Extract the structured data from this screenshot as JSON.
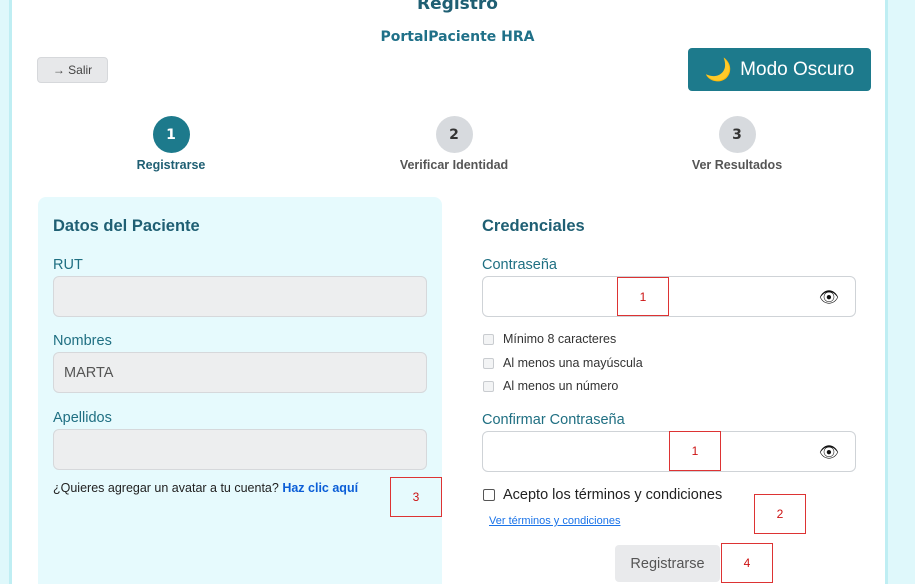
{
  "header": {
    "title": "Registro",
    "subtitle": "PortalPaciente HRA"
  },
  "toolbar": {
    "exit_label": "→ Salir",
    "dark_mode_label": "Modo Oscuro",
    "dark_mode_icon": "🌙"
  },
  "steps": [
    {
      "number": "1",
      "label": "Registrarse"
    },
    {
      "number": "2",
      "label": "Verificar Identidad"
    },
    {
      "number": "3",
      "label": "Ver Resultados"
    }
  ],
  "patient": {
    "title": "Datos del Paciente",
    "rut_label": "RUT",
    "rut_value": "",
    "names_label": "Nombres",
    "names_value": "MARTA",
    "lastnames_label": "Apellidos",
    "lastnames_value": "",
    "avatar_prompt": "¿Quieres agregar un avatar a tu cuenta?",
    "avatar_link": "Haz clic aquí"
  },
  "credentials": {
    "title": "Credenciales",
    "password_label": "Contraseña",
    "password_value": "",
    "rules": [
      "Mínimo 8 caracteres",
      "Al menos una mayúscula",
      "Al menos un número"
    ],
    "confirm_label": "Confirmar Contraseña",
    "confirm_value": "",
    "eye_icon": "👁",
    "terms_label": "Acepto los términos y condiciones",
    "terms_link": "Ver términos y condiciones",
    "submit_label": "Registrarse"
  },
  "annotations": [
    "1",
    "1",
    "3",
    "2",
    "4"
  ]
}
